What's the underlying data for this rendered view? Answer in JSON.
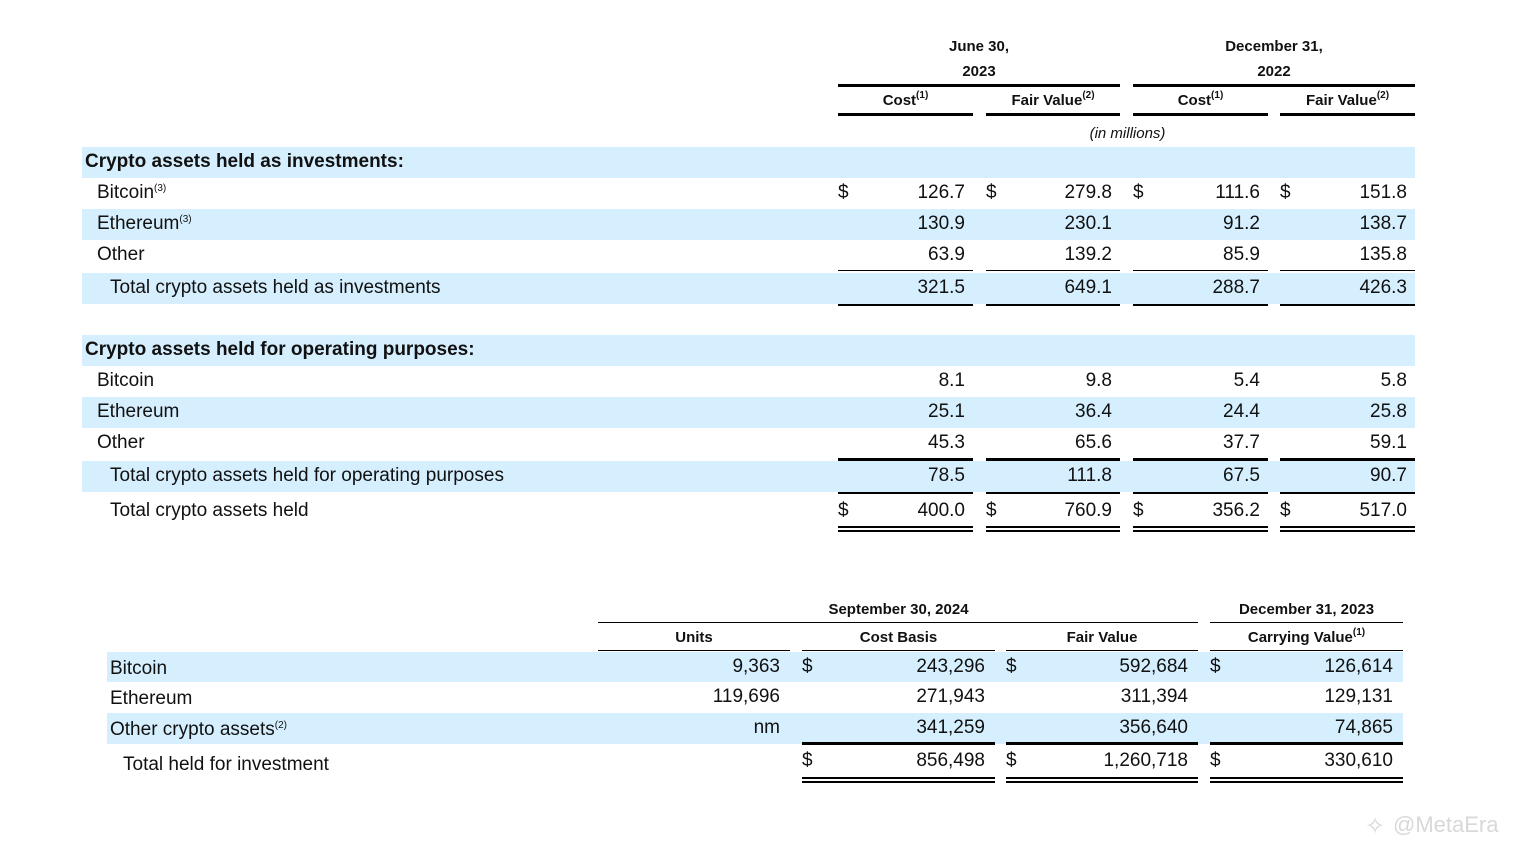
{
  "table1": {
    "period_headers": [
      {
        "line1": "June 30,",
        "line2": "2023"
      },
      {
        "line1": "December 31,",
        "line2": "2022"
      }
    ],
    "columns": [
      {
        "label": "Cost",
        "note": "(1)"
      },
      {
        "label": "Fair Value",
        "note": "(2)"
      },
      {
        "label": "Cost",
        "note": "(1)"
      },
      {
        "label": "Fair Value",
        "note": "(2)"
      }
    ],
    "units_note": "(in millions)",
    "currency": "$",
    "sections": [
      {
        "title": "Crypto assets held as investments:",
        "rows": [
          {
            "label": "Bitcoin",
            "note": "(3)",
            "values": [
              "126.7",
              "279.8",
              "111.6",
              "151.8"
            ]
          },
          {
            "label": "Ethereum",
            "note": "(3)",
            "values": [
              "130.9",
              "230.1",
              "91.2",
              "138.7"
            ]
          },
          {
            "label": "Other",
            "note": "",
            "values": [
              "63.9",
              "139.2",
              "85.9",
              "135.8"
            ]
          }
        ],
        "total": {
          "label": "Total crypto assets held as investments",
          "values": [
            "321.5",
            "649.1",
            "288.7",
            "426.3"
          ]
        }
      },
      {
        "title": "Crypto assets held for operating purposes:",
        "rows": [
          {
            "label": "Bitcoin",
            "note": "",
            "values": [
              "8.1",
              "9.8",
              "5.4",
              "5.8"
            ]
          },
          {
            "label": "Ethereum",
            "note": "",
            "values": [
              "25.1",
              "36.4",
              "24.4",
              "25.8"
            ]
          },
          {
            "label": "Other",
            "note": "",
            "values": [
              "45.3",
              "65.6",
              "37.7",
              "59.1"
            ]
          }
        ],
        "total": {
          "label": "Total crypto assets held for operating purposes",
          "values": [
            "78.5",
            "111.8",
            "67.5",
            "90.7"
          ]
        }
      }
    ],
    "grand_total": {
      "label": "Total crypto assets held",
      "values": [
        "400.0",
        "760.9",
        "356.2",
        "517.0"
      ]
    }
  },
  "table2": {
    "period_headers": [
      "September 30, 2024",
      "December 31, 2023"
    ],
    "columns": [
      {
        "label": "Units",
        "note": ""
      },
      {
        "label": "Cost Basis",
        "note": ""
      },
      {
        "label": "Fair Value",
        "note": ""
      },
      {
        "label": "Carrying Value",
        "note": "(1)"
      }
    ],
    "currency": "$",
    "rows": [
      {
        "label": "Bitcoin",
        "note": "",
        "values": [
          "9,363",
          "243,296",
          "592,684",
          "126,614"
        ]
      },
      {
        "label": "Ethereum",
        "note": "",
        "values": [
          "119,696",
          "271,943",
          "311,394",
          "129,131"
        ]
      },
      {
        "label": "Other crypto assets",
        "note": "(2)",
        "values": [
          "nm",
          "341,259",
          "356,640",
          "74,865"
        ]
      }
    ],
    "total": {
      "label": "Total held for investment",
      "values": [
        "856,498",
        "1,260,718",
        "330,610"
      ]
    }
  },
  "watermark": "@MetaEra",
  "colors": {
    "band": "#d6efff",
    "rule": "#000000"
  }
}
